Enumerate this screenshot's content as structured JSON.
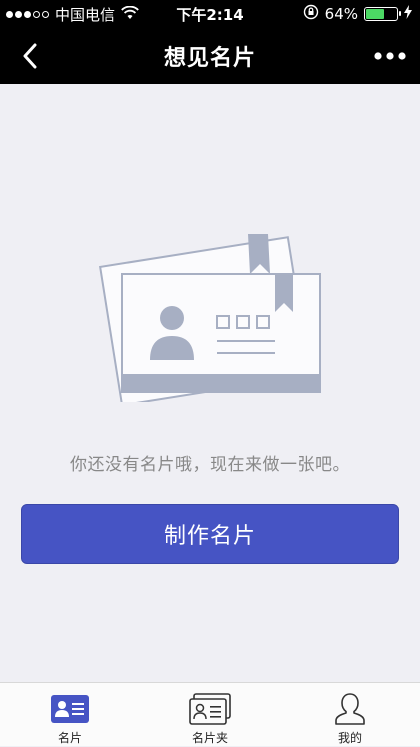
{
  "status_bar": {
    "carrier": "中国电信",
    "time": "下午2:14",
    "battery_percent": "64%",
    "battery_level": 0.64
  },
  "nav": {
    "title": "想见名片"
  },
  "empty_state": {
    "message": "你还没有名片哦，现在来做一张吧。",
    "button_label": "制作名片"
  },
  "tabs": [
    {
      "label": "名片",
      "icon": "card-icon",
      "active": true
    },
    {
      "label": "名片夹",
      "icon": "card-holder-icon",
      "active": false
    },
    {
      "label": "我的",
      "icon": "profile-icon",
      "active": false
    }
  ],
  "colors": {
    "accent": "#4654c4",
    "navbar": "#000000",
    "background": "#efeff4",
    "illustration": "#a7afc3"
  }
}
